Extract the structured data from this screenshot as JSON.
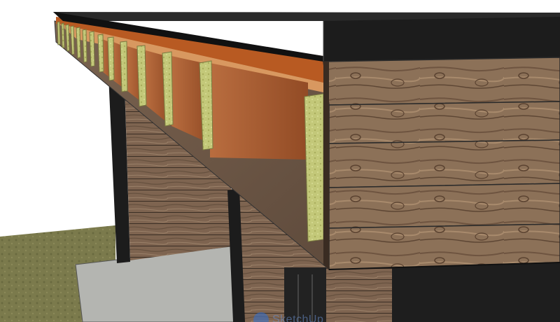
{
  "scene": {
    "subject": "shed-roof-overhang-3d-model",
    "colors": {
      "sky": "#ffffff",
      "grass": "#7b7a4c",
      "concrete": "#b4b5b1",
      "fascia": "#1c1c1c",
      "rafter": "#a3592e",
      "insulation": "#c3c879",
      "siding": "#8c7158",
      "soffit": "#6e5846"
    }
  },
  "watermark": {
    "text": "SketchUp",
    "logo_icon": "sketchup-logo-icon"
  }
}
